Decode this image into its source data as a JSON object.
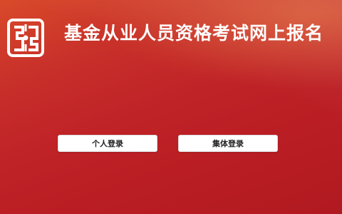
{
  "header": {
    "title": "基金从业人员资格考试网上报名",
    "logo_icon": "association-seal-logo"
  },
  "login": {
    "personal_label": "个人登录",
    "group_label": "集体登录"
  },
  "colors": {
    "background_top": "#d94a2a",
    "background_bottom": "#b01a20",
    "button_bg": "#ffffff",
    "button_text": "#222222"
  }
}
